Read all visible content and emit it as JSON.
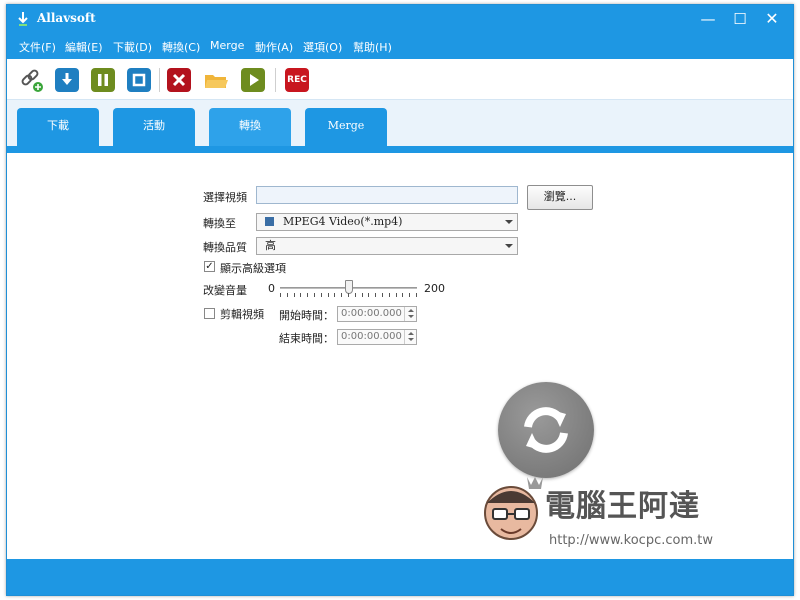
{
  "window": {
    "title": "Allavsoft",
    "controls": {
      "minimize": "—",
      "maximize": "☐",
      "close": "✕"
    }
  },
  "menu": {
    "items": [
      "文件(F)",
      "編輯(E)",
      "下載(D)",
      "轉換(C)",
      "Merge",
      "動作(A)",
      "選項(O)",
      "幫助(H)"
    ]
  },
  "toolbar": {
    "buttons": [
      {
        "icon": "paste-link-icon"
      },
      {
        "icon": "download-icon"
      },
      {
        "icon": "pause-icon"
      },
      {
        "icon": "stop-icon"
      },
      {
        "icon": "delete-icon"
      },
      {
        "icon": "folder-icon"
      },
      {
        "icon": "play-icon"
      },
      {
        "icon": "record-icon",
        "label": "REC"
      }
    ],
    "colors": {
      "blue": "#1f7fc1",
      "green": "#6e8c1f",
      "red": "#b3121d",
      "folder": "#f0b53a"
    }
  },
  "tabs": [
    {
      "label": "下載",
      "active": false
    },
    {
      "label": "活動",
      "active": false
    },
    {
      "label": "轉換",
      "active": true
    },
    {
      "label": "Merge",
      "active": false
    }
  ],
  "convert_panel": {
    "select_video_label": "選擇視頻",
    "select_video_value": "",
    "browse_label": "瀏覽...",
    "convert_to_label": "轉換至",
    "convert_to_value": "MPEG4 Video(*.mp4)",
    "quality_label": "轉換品質",
    "quality_value": "高",
    "show_advanced_label": "顯示高級選項",
    "show_advanced_checked": true,
    "volume_label": "改變音量",
    "volume_min": "0",
    "volume_max": "200",
    "volume_value": 100,
    "trim_label": "剪輯視頻",
    "trim_checked": false,
    "start_time_label": "開始時間：",
    "start_time_value": "0:00:00.000",
    "end_time_label": "結束時間：",
    "end_time_value": "0:00:00.000",
    "convert_button_icon": "refresh-icon"
  },
  "watermark": {
    "title": "電腦王阿達",
    "url": "http://www.kocpc.com.tw"
  },
  "colors": {
    "accent": "#1e97e3",
    "tab_strip_bg": "#eaf3fb",
    "convert_button": "#7a7a7a"
  }
}
